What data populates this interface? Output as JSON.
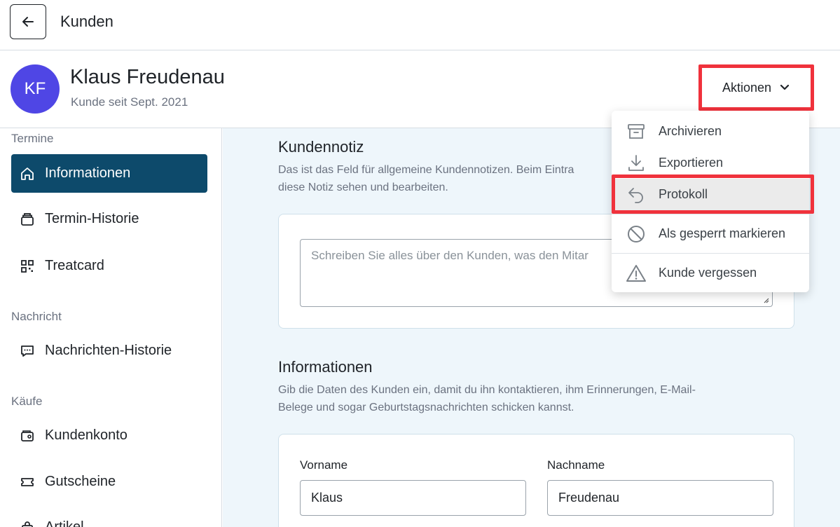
{
  "topbar": {
    "title": "Kunden"
  },
  "customer": {
    "initials": "KF",
    "name": "Klaus Freudenau",
    "since": "Kunde seit Sept. 2021"
  },
  "actions": {
    "label": "Aktionen"
  },
  "sidebar": {
    "sections": [
      {
        "label": "Termine"
      },
      {
        "label": "Nachricht"
      },
      {
        "label": "Käufe"
      }
    ],
    "items": [
      {
        "label": "Informationen",
        "icon": "home-icon",
        "active": true
      },
      {
        "label": "Termin-Historie",
        "icon": "calendar-stack-icon"
      },
      {
        "label": "Treatcard",
        "icon": "qr-code-icon"
      },
      {
        "label": "Nachrichten-Historie",
        "icon": "chat-icon"
      },
      {
        "label": "Kundenkonto",
        "icon": "wallet-icon"
      },
      {
        "label": "Gutscheine",
        "icon": "ticket-icon"
      },
      {
        "label": "Artikel",
        "icon": "bag-icon"
      }
    ]
  },
  "note": {
    "title": "Kundennotiz",
    "description": "Das ist das Feld für allgemeine Kundennotizen. Beim Eintra",
    "description_line2": "diese Notiz sehen und bearbeiten.",
    "placeholder": "Schreiben Sie alles über den Kunden, was den Mitar"
  },
  "info": {
    "title": "Informationen",
    "description_line1": "Gib die Daten des Kunden ein, damit du ihn kontaktieren, ihm Erinnerungen, E-Mail-",
    "description_line2": "Belege und sogar Geburtstagsnachrichten schicken kannst.",
    "firstname_label": "Vorname",
    "firstname_value": "Klaus",
    "lastname_label": "Nachname",
    "lastname_value": "Freudenau"
  },
  "menu": {
    "items": [
      {
        "label": "Archivieren",
        "icon": "archive-icon"
      },
      {
        "label": "Exportieren",
        "icon": "download-icon"
      },
      {
        "label": "Protokoll",
        "icon": "undo-arrow-icon"
      },
      {
        "label": "Als gesperrt markieren",
        "icon": "block-icon"
      },
      {
        "label": "Kunde vergessen",
        "icon": "warning-icon"
      }
    ]
  },
  "colors": {
    "accent": "#0d4a6b",
    "avatar": "#4f46e5",
    "highlight": "#f0323c",
    "background": "#eef6fb"
  }
}
